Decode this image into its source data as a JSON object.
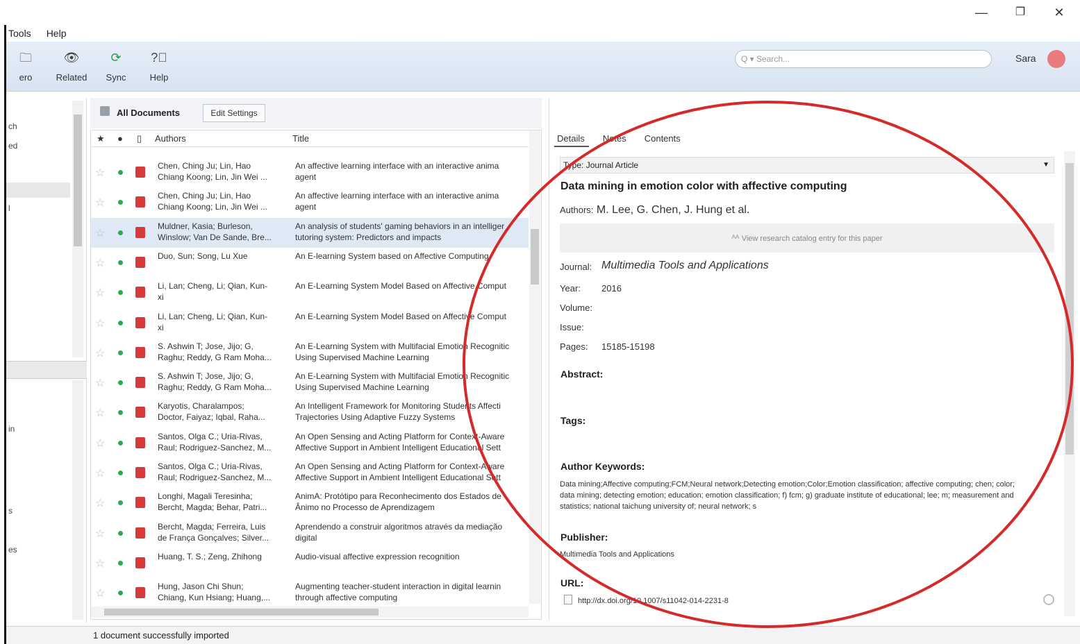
{
  "window": {
    "menu": [
      "Tools",
      "Help"
    ],
    "controls": {
      "minimize": "—",
      "restore": "❐",
      "close": "✕"
    }
  },
  "toolbar": {
    "buttons": [
      {
        "label": "ero",
        "icon": "folder-icon"
      },
      {
        "label": "Related",
        "icon": "eye-icon"
      },
      {
        "label": "Sync",
        "icon": "sync-icon"
      },
      {
        "label": "Help",
        "icon": "help-icon"
      }
    ],
    "search_placeholder": "Q ▾ Search...",
    "user": "Sara"
  },
  "sidebar": {
    "labels": [
      "ch",
      "ed",
      "l",
      "in",
      "s",
      "es"
    ]
  },
  "documents": {
    "header": "All Documents",
    "edit_settings": "Edit Settings",
    "columns": {
      "authors": "Authors",
      "title": "Title"
    },
    "rows": [
      {
        "authors": "Chen, Ching Ju; Lin, Hao\nChiang Koong; Lin, Jin Wei ...",
        "title": "An affective learning interface with an interactive anima\nagent",
        "selected": false
      },
      {
        "authors": "Chen, Ching Ju; Lin, Hao\nChiang Koong; Lin, Jin Wei ...",
        "title": "An affective learning interface with an interactive anima\nagent",
        "selected": false
      },
      {
        "authors": "Muldner, Kasia; Burleson,\nWinslow; Van De Sande, Bre...",
        "title": "An analysis of students' gaming behaviors in an intelliger\ntutoring system: Predictors and impacts",
        "selected": true
      },
      {
        "authors": "Duo, Sun; Song, Lu Xue",
        "title": "An E-learning System based on Affective Computing",
        "selected": false
      },
      {
        "authors": "Li, Lan; Cheng, Li; Qian, Kun-\nxi",
        "title": "An E-Learning System Model Based on Affective Comput",
        "selected": false
      },
      {
        "authors": "Li, Lan; Cheng, Li; Qian, Kun-\nxi",
        "title": "An E-Learning System Model Based on Affective Comput",
        "selected": false
      },
      {
        "authors": "S. Ashwin T; Jose, Jijo; G,\nRaghu; Reddy, G Ram Moha...",
        "title": "An E-Learning System with Multifacial Emotion Recognitic\nUsing Supervised Machine Learning",
        "selected": false
      },
      {
        "authors": "S. Ashwin T; Jose, Jijo; G,\nRaghu; Reddy, G Ram Moha...",
        "title": "An E-Learning System with Multifacial Emotion Recognitic\nUsing Supervised Machine Learning",
        "selected": false
      },
      {
        "authors": "Karyotis, Charalampos;\nDoctor, Faiyaz; Iqbal, Raha...",
        "title": "An Intelligent Framework for Monitoring Students Affecti\nTrajectories Using Adaptive Fuzzy Systems",
        "selected": false
      },
      {
        "authors": "Santos, Olga C.; Uria-Rivas,\nRaul; Rodriguez-Sanchez, M...",
        "title": "An Open Sensing and Acting Platform for Context-Aware\nAffective Support in Ambient Intelligent Educational Sett",
        "selected": false
      },
      {
        "authors": "Santos, Olga C.; Uria-Rivas,\nRaul; Rodriguez-Sanchez, M...",
        "title": "An Open Sensing and Acting Platform for Context-Aware\nAffective Support in Ambient Intelligent Educational Sett",
        "selected": false
      },
      {
        "authors": "Longhi, Magali Teresinha;\nBercht, Magda; Behar, Patri...",
        "title": "AnimA: Protótipo para Reconhecimento dos Estados de\nÂnimo no Processo de Aprendizagem",
        "selected": false
      },
      {
        "authors": "Bercht, Magda; Ferreira, Luis\nde França Gonçalves; Silver...",
        "title": "Aprendendo a construir algoritmos através da mediação\ndigital",
        "selected": false
      },
      {
        "authors": "Huang, T. S.; Zeng, Zhihong",
        "title": "Audio-visual affective expression recognition",
        "selected": false
      },
      {
        "authors": "Hung, Jason Chi Shun;\nChiang, Kun Hsiang; Huang,...",
        "title": "Augmenting teacher-student interaction in digital learnin\nthrough affective computing",
        "selected": false
      }
    ]
  },
  "details": {
    "tabs": [
      "Details",
      "Notes",
      "Contents"
    ],
    "type_label": "Type:",
    "type_value": "Journal Article",
    "title": "Data mining in emotion color with affective computing",
    "authors_label": "Authors:",
    "authors_value": "M. Lee, G. Chen, J. Hung et al.",
    "catalog_note": "View research catalog entry for this paper",
    "fields": [
      {
        "label": "Journal:",
        "value": "Multimedia Tools and Applications"
      },
      {
        "label": "Year:",
        "value": "2016"
      },
      {
        "label": "Volume:",
        "value": ""
      },
      {
        "label": "Issue:",
        "value": ""
      },
      {
        "label": "Pages:",
        "value": "15185-15198"
      }
    ],
    "abstract_label": "Abstract:",
    "tags_label": "Tags:",
    "keywords_label": "Author Keywords:",
    "keywords": "Data mining;Affective computing;FCM;Neural network;Detecting emotion;Color;Emotion classification; affective computing; chen; color; data mining; detecting emotion; education; emotion classification; f) fcm; g) graduate institute of educational; lee; m; measurement and statistics; national taichung university of; neural network; s",
    "publisher_label": "Publisher:",
    "publisher": "Multimedia Tools and Applications",
    "url_label": "URL:",
    "url": "http://dx.doi.org/10.1007/s11042-014-2231-8"
  },
  "status": "1 document successfully imported",
  "colors": {
    "annotation": "#d42a2a",
    "toolbar": "#dfe8f3",
    "selected_row": "#dfe9f6",
    "pdf": "#d63a3a",
    "read_dot": "#2fa84f"
  }
}
